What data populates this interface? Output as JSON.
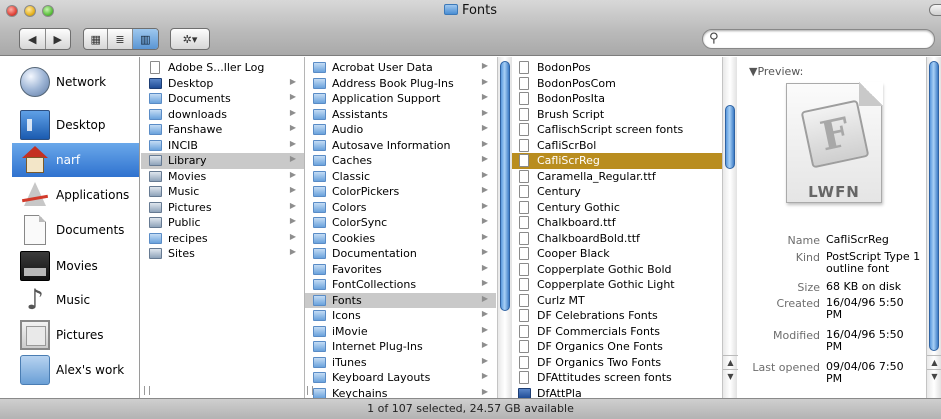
{
  "window": {
    "title": "Fonts",
    "toolbar": {
      "back": "◀",
      "forward": "▶",
      "view_icon": "▦",
      "view_list": "≣",
      "view_column": "▥",
      "action": "✲▾"
    },
    "search": {
      "placeholder": "",
      "value": ""
    }
  },
  "sidebar": [
    {
      "label": "Network",
      "icon": "network-icon"
    },
    {
      "label": "Desktop",
      "icon": "desktop-icon"
    },
    {
      "label": "narf",
      "icon": "home-icon",
      "selected": true
    },
    {
      "label": "Applications",
      "icon": "applications-icon"
    },
    {
      "label": "Documents",
      "icon": "documents-icon"
    },
    {
      "label": "Movies",
      "icon": "movies-icon"
    },
    {
      "label": "Music",
      "icon": "music-icon"
    },
    {
      "label": "Pictures",
      "icon": "pictures-icon"
    },
    {
      "label": "Alex's work",
      "icon": "folder-icon"
    }
  ],
  "columns": [
    {
      "items": [
        {
          "name": "Adobe S...ller Log",
          "kind": "file",
          "arrow": false
        },
        {
          "name": "Desktop",
          "kind": "special",
          "arrow": true
        },
        {
          "name": "Documents",
          "kind": "folder",
          "arrow": true
        },
        {
          "name": "downloads",
          "kind": "folder",
          "arrow": true
        },
        {
          "name": "Fanshawe",
          "kind": "folder",
          "arrow": true
        },
        {
          "name": "INCIB",
          "kind": "folder",
          "arrow": true
        },
        {
          "name": "Library",
          "kind": "sysfolder",
          "arrow": true,
          "state": "highlight"
        },
        {
          "name": "Movies",
          "kind": "sysfolder",
          "arrow": true
        },
        {
          "name": "Music",
          "kind": "sysfolder",
          "arrow": true
        },
        {
          "name": "Pictures",
          "kind": "sysfolder",
          "arrow": true
        },
        {
          "name": "Public",
          "kind": "sysfolder",
          "arrow": true
        },
        {
          "name": "recipes",
          "kind": "folder",
          "arrow": true
        },
        {
          "name": "Sites",
          "kind": "sysfolder",
          "arrow": true
        }
      ]
    },
    {
      "items": [
        {
          "name": "Acrobat User Data",
          "kind": "folder",
          "arrow": true
        },
        {
          "name": "Address Book Plug-Ins",
          "kind": "folder",
          "arrow": true
        },
        {
          "name": "Application Support",
          "kind": "folder",
          "arrow": true
        },
        {
          "name": "Assistants",
          "kind": "folder",
          "arrow": true
        },
        {
          "name": "Audio",
          "kind": "folder",
          "arrow": true
        },
        {
          "name": "Autosave Information",
          "kind": "folder",
          "arrow": true
        },
        {
          "name": "Caches",
          "kind": "folder",
          "arrow": true
        },
        {
          "name": "Classic",
          "kind": "folder",
          "arrow": true
        },
        {
          "name": "ColorPickers",
          "kind": "folder",
          "arrow": true
        },
        {
          "name": "Colors",
          "kind": "folder",
          "arrow": true
        },
        {
          "name": "ColorSync",
          "kind": "folder",
          "arrow": true
        },
        {
          "name": "Cookies",
          "kind": "folder",
          "arrow": true
        },
        {
          "name": "Documentation",
          "kind": "folder",
          "arrow": true
        },
        {
          "name": "Favorites",
          "kind": "folder",
          "arrow": true
        },
        {
          "name": "FontCollections",
          "kind": "folder",
          "arrow": true
        },
        {
          "name": "Fonts",
          "kind": "folder",
          "arrow": true,
          "state": "highlight"
        },
        {
          "name": "Icons",
          "kind": "folder",
          "arrow": true
        },
        {
          "name": "iMovie",
          "kind": "folder",
          "arrow": true
        },
        {
          "name": "Internet Plug-Ins",
          "kind": "folder",
          "arrow": true
        },
        {
          "name": "iTunes",
          "kind": "folder",
          "arrow": true
        },
        {
          "name": "Keyboard Layouts",
          "kind": "folder",
          "arrow": true
        },
        {
          "name": "Keychains",
          "kind": "folder",
          "arrow": true
        }
      ]
    },
    {
      "items": [
        {
          "name": "BodonPos",
          "kind": "file",
          "arrow": false
        },
        {
          "name": "BodonPosCom",
          "kind": "file",
          "arrow": false
        },
        {
          "name": "BodonPosIta",
          "kind": "file",
          "arrow": false
        },
        {
          "name": "Brush Script",
          "kind": "file",
          "arrow": false
        },
        {
          "name": "CaflischScript screen fonts",
          "kind": "file",
          "arrow": false
        },
        {
          "name": "CafliScrBol",
          "kind": "file",
          "arrow": false
        },
        {
          "name": "CafliScrReg",
          "kind": "file",
          "arrow": false,
          "state": "selected"
        },
        {
          "name": "Caramella_Regular.ttf",
          "kind": "file",
          "arrow": false
        },
        {
          "name": "Century",
          "kind": "file",
          "arrow": false
        },
        {
          "name": "Century Gothic",
          "kind": "file",
          "arrow": false
        },
        {
          "name": "Chalkboard.ttf",
          "kind": "file",
          "arrow": false
        },
        {
          "name": "ChalkboardBold.ttf",
          "kind": "file",
          "arrow": false
        },
        {
          "name": "Cooper Black",
          "kind": "file",
          "arrow": false
        },
        {
          "name": "Copperplate Gothic Bold",
          "kind": "file",
          "arrow": false
        },
        {
          "name": "Copperplate Gothic Light",
          "kind": "file",
          "arrow": false
        },
        {
          "name": "Curlz MT",
          "kind": "file",
          "arrow": false
        },
        {
          "name": "DF Celebrations Fonts",
          "kind": "file",
          "arrow": false
        },
        {
          "name": "DF Commercials Fonts",
          "kind": "file",
          "arrow": false
        },
        {
          "name": "DF Organics One Fonts",
          "kind": "file",
          "arrow": false
        },
        {
          "name": "DF Organics Two Fonts",
          "kind": "file",
          "arrow": false
        },
        {
          "name": "DFAttitudes screen fonts",
          "kind": "file",
          "arrow": false
        },
        {
          "name": "DfAttPla",
          "kind": "special",
          "arrow": false
        }
      ]
    }
  ],
  "preview": {
    "heading": "▼Preview:",
    "badge": "LWFN",
    "glyph": "F",
    "fields": [
      {
        "key": "Name",
        "value": "CafliScrReg"
      },
      {
        "key": "Kind",
        "value": "PostScript Type 1 outline font"
      },
      {
        "key": "Size",
        "value": "68 KB on disk"
      },
      {
        "key": "Created",
        "value": "16/04/96 5:50 PM"
      },
      {
        "key": "Modified",
        "value": "16/04/96 5:50 PM"
      },
      {
        "key": "Last opened",
        "value": "09/04/06 7:50 PM"
      }
    ]
  },
  "status": "1 of 107 selected, 24.57 GB available"
}
